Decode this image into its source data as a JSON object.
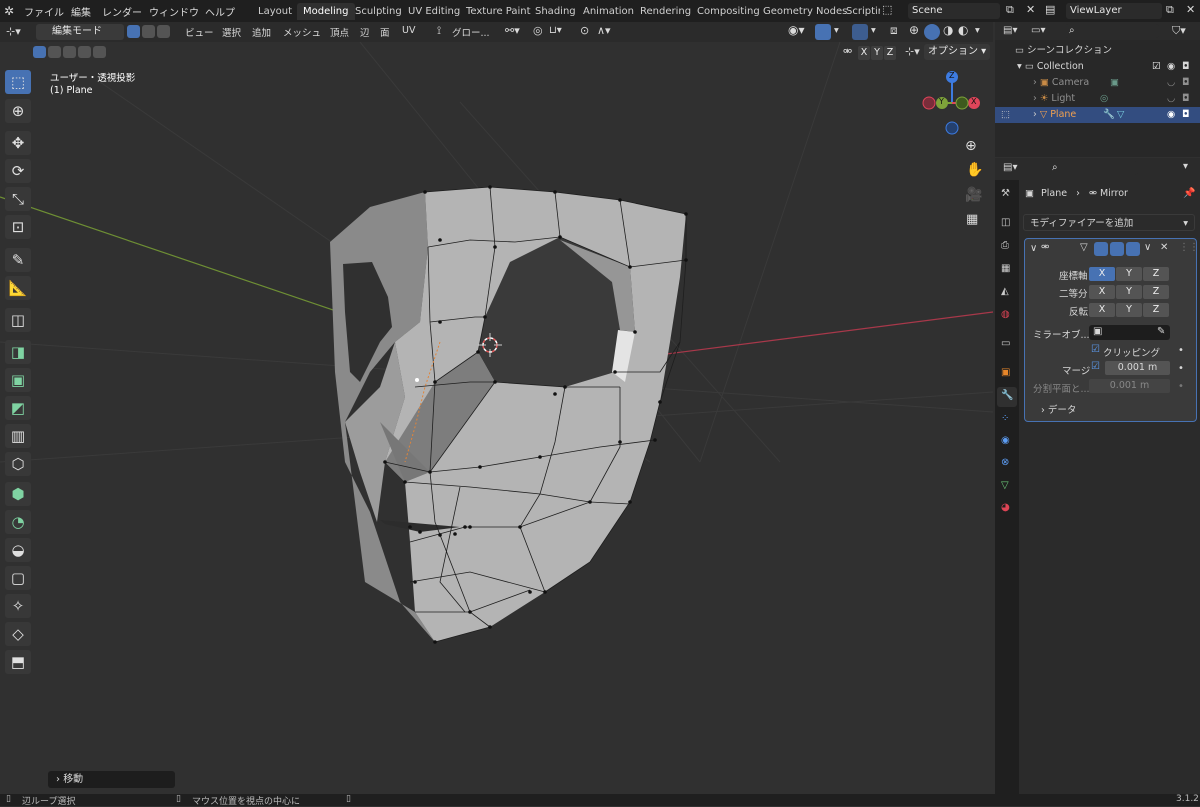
{
  "top_menu": [
    "ファイル",
    "編集",
    "レンダー",
    "ウィンドウ",
    "ヘルプ"
  ],
  "workspaces": [
    "Layout",
    "Modeling",
    "Sculpting",
    "UV Editing",
    "Texture Paint",
    "Shading",
    "Animation",
    "Rendering",
    "Compositing",
    "Geometry Nodes",
    "Scriptir"
  ],
  "active_workspace": "Modeling",
  "scene_name": "Scene",
  "view_layer": "ViewLayer",
  "viewport_header": {
    "mode": "編集モード",
    "menus": [
      "ビュー",
      "選択",
      "追加",
      "メッシュ",
      "頂点",
      "辺",
      "面",
      "UV"
    ],
    "transform": "グロー...",
    "options": "オプション",
    "axes": [
      "X",
      "Y",
      "Z"
    ]
  },
  "viewport_overlay": {
    "view_name": "ユーザー・透視投影",
    "object_label": "(1) Plane",
    "operator_panel": "移動",
    "gizmo_axes": [
      "Z",
      "Y",
      "X"
    ]
  },
  "outliner": {
    "title": "シーンコレクション",
    "items": [
      {
        "name": "Collection",
        "icon": "collection-icon"
      },
      {
        "name": "Camera",
        "icon": "camera-icon"
      },
      {
        "name": "Light",
        "icon": "light-icon"
      },
      {
        "name": "Plane",
        "icon": "mesh-icon",
        "selected": true
      }
    ]
  },
  "properties": {
    "breadcrumb_object": "Plane",
    "breadcrumb_modifier": "Mirror",
    "add_modifier": "モディファイアーを追加",
    "rows": {
      "axis_label": "座標軸",
      "bisect_label": "二等分",
      "flip_label": "反転",
      "mirror_object_label": "ミラーオブ...",
      "clipping_label": "クリッピング",
      "merge_label": "マージ",
      "merge_value": "0.001 m",
      "bisect_distance_label": "分割平面と...",
      "bisect_distance_value": "0.001 m",
      "data_label": "データ"
    },
    "xyz": [
      "X",
      "Y",
      "Z"
    ]
  },
  "status": {
    "left": "辺ループ選択",
    "middle": "マウス位置を視点の中心に",
    "version": "3.1.2"
  },
  "colors": {
    "accent": "#4772b3",
    "x_axis": "#e0455a",
    "y_axis": "#7ea33a",
    "z_axis": "#3d7be0"
  }
}
